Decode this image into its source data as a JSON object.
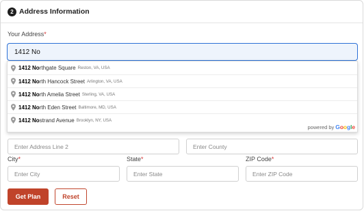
{
  "section": {
    "step": "2",
    "title": "Address Information"
  },
  "address": {
    "label": "Your Address",
    "required_mark": "*",
    "value": "1412 No"
  },
  "suggestions": [
    {
      "match": "1412 No",
      "rest": "rthgate Square",
      "secondary": "Reston, VA, USA"
    },
    {
      "match": "1412 No",
      "rest": "rth Hancock Street",
      "secondary": "Arlington, VA, USA"
    },
    {
      "match": "1412 No",
      "rest": "rth Amelia Street",
      "secondary": "Sterling, VA, USA"
    },
    {
      "match": "1412 No",
      "rest": "rth Eden Street",
      "secondary": "Baltimore, MD, USA"
    },
    {
      "match": "1412 No",
      "rest": "strand Avenue",
      "secondary": "Brooklyn, NY, USA"
    }
  ],
  "powered_by": {
    "text": "powered by",
    "logo": [
      "G",
      "o",
      "o",
      "g",
      "l",
      "e"
    ]
  },
  "address_line_2": {
    "placeholder": "Enter Address Line 2"
  },
  "county": {
    "placeholder": "Enter County"
  },
  "city": {
    "label": "City",
    "required_mark": "*",
    "placeholder": "Enter City"
  },
  "state": {
    "label": "State",
    "required_mark": "*",
    "placeholder": "Enter State"
  },
  "zip": {
    "label": "ZIP Code",
    "required_mark": "*",
    "placeholder": "Enter ZIP Code"
  },
  "buttons": {
    "primary": "Get Plan",
    "secondary": "Reset"
  },
  "colors": {
    "accent": "#c0432a",
    "focus_border": "#2a6fd6",
    "required": "#d22f2f"
  },
  "icons": {
    "suggestion": "map-pin-icon"
  }
}
